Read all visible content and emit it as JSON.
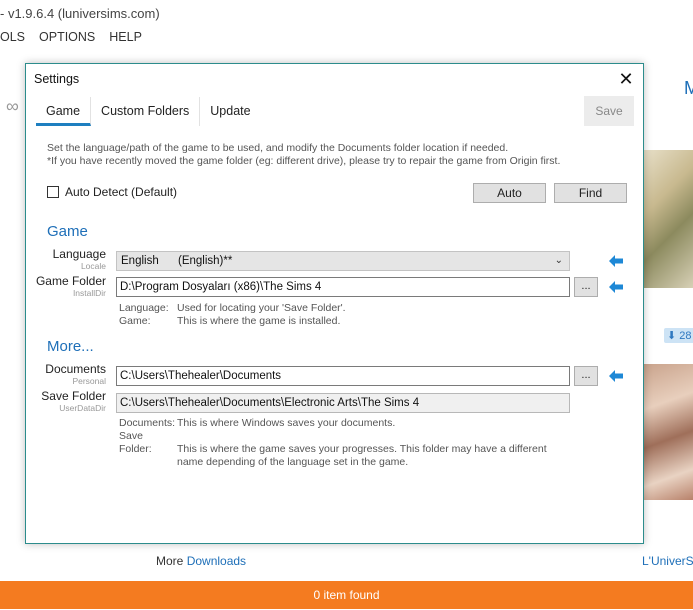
{
  "app": {
    "title": "- v1.9.6.4  (luniversims.com)",
    "menu": [
      "OLS",
      "OPTIONS",
      "HELP"
    ],
    "infinity_glyph": "∞",
    "right_letter": "M",
    "download_badge": "⬇ 28",
    "more_prefix": "More",
    "more_link": "Downloads",
    "universims_link": "L'UniverSim",
    "status": "0 item found",
    "accent_color": "#f47b20"
  },
  "dialog": {
    "title": "Settings",
    "close_glyph": "✕",
    "tabs": [
      "Game",
      "Custom Folders",
      "Update"
    ],
    "active_tab": "Game",
    "save_label": "Save",
    "intro_line1": "Set the language/path of the game to be used, and modify the Documents folder location if needed.",
    "intro_line2": "*If you have recently moved the game folder (eg: different drive), please try to repair the game from Origin first.",
    "autodetect_label": "Auto Detect (Default)",
    "autodetect_checked": false,
    "auto_button": "Auto",
    "find_button": "Find",
    "game_section": "Game",
    "language_label": "Language",
    "language_sublabel": "Locale",
    "language_value_a": "English",
    "language_value_b": "(English)**",
    "game_folder_label": "Game Folder",
    "game_folder_sublabel": "InstallDir",
    "game_folder_value": "D:\\Program Dosyaları (x86)\\The Sims 4",
    "browse_label": "...",
    "help1_key1": "Language:",
    "help1_val1": "Used for locating your 'Save Folder'.",
    "help1_key2": "Game:",
    "help1_val2": "This is where the game is installed.",
    "more_section": "More...",
    "documents_label": "Documents",
    "documents_sublabel": "Personal",
    "documents_value": "C:\\Users\\Thehealer\\Documents",
    "save_folder_label": "Save Folder",
    "save_folder_sublabel": "UserDataDir",
    "save_folder_value": "C:\\Users\\Thehealer\\Documents\\Electronic Arts\\The Sims 4",
    "help2_key1": "Documents:",
    "help2_val1": "This is where Windows saves your documents.",
    "help2_key2": "Save Folder:",
    "help2_val2": "This is where the game saves your progresses. This folder may have a different",
    "help2_val3": "name depending of the language set in the game.",
    "arrow_color": "#1e88d6"
  }
}
